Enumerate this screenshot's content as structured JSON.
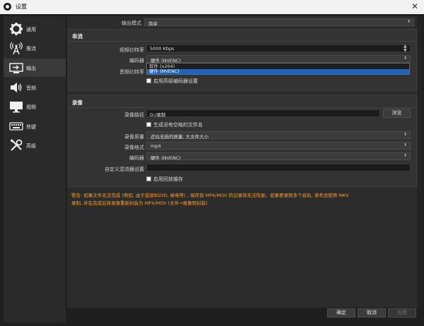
{
  "window": {
    "title": "设置",
    "close_glyph": "✕"
  },
  "sidebar": {
    "items": [
      {
        "label": "通用",
        "icon": "gear-icon"
      },
      {
        "label": "推流",
        "icon": "broadcast-icon"
      },
      {
        "label": "输出",
        "icon": "output-icon",
        "active": true
      },
      {
        "label": "音频",
        "icon": "speaker-icon"
      },
      {
        "label": "视频",
        "icon": "monitor-icon"
      },
      {
        "label": "热键",
        "icon": "keyboard-icon"
      },
      {
        "label": "高级",
        "icon": "tools-icon"
      }
    ]
  },
  "output_mode": {
    "label": "输出模式",
    "value": "简单"
  },
  "streaming": {
    "title": "串流",
    "video_bitrate_label": "视频比特率",
    "video_bitrate_value": "5000 Kbps",
    "encoder_label": "编码器",
    "encoder_value": "硬件 (NVENC)",
    "audio_bitrate_label": "音频比特率",
    "advanced_encoder_label": "启用高级编码器设置",
    "encoder_options": [
      {
        "label": "软件 (x264)",
        "selected": false
      },
      {
        "label": "硬件 (NVENC)",
        "selected": true
      }
    ]
  },
  "recording": {
    "title": "录像",
    "path_label": "录像路径",
    "path_value": "D:/录制",
    "browse_label": "浏览",
    "no_space_label": "生成没有空格的文件名",
    "quality_label": "录像质量",
    "quality_value": "近似无损的质量, 大文件大小",
    "format_label": "录像格式",
    "format_value": "mp4",
    "encoder_label": "编码器",
    "encoder_value": "硬件 (NVENC)",
    "muxer_label": "自定义混流器设置",
    "muxer_value": "",
    "replay_buffer_label": "启用回放缓存"
  },
  "warning": {
    "line1": "警告: 如果文件无法完成 (例如, 由于蓝屏BSOD, 掉电等) , 保存到 MP4/MOV 的记录将无法恢复。如果要录制多个音轨, 请考虑使用 MKV",
    "line2": "录制, 并在完成后将录像重新封装为 MP4/MOV (文件→录像转封装)"
  },
  "footer": {
    "ok": "确定",
    "cancel": "取消",
    "apply": "应用"
  },
  "colors": {
    "warning": "#ff9b26",
    "selection": "#1e66b5"
  }
}
